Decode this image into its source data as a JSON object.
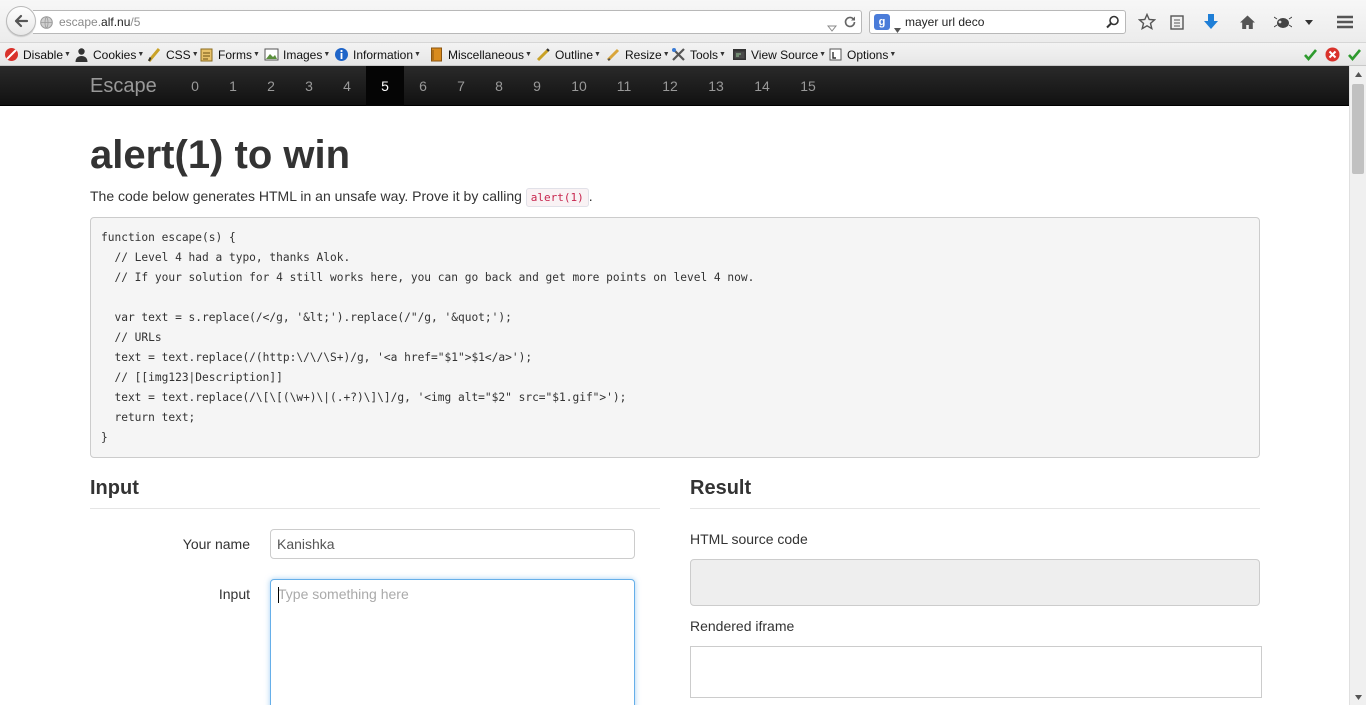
{
  "browser": {
    "url_prefix": "escape.",
    "url_domain": "alf.nu",
    "url_path": "/5",
    "search_engine_icon": "google-icon",
    "search_engine_letter": "g",
    "search_query": "mayer url deco"
  },
  "addon_bar": {
    "items": [
      {
        "label": "Disable",
        "icon": "disable-icon"
      },
      {
        "label": "Cookies",
        "icon": "cookies-icon"
      },
      {
        "label": "CSS",
        "icon": "css-icon"
      },
      {
        "label": "Forms",
        "icon": "forms-icon"
      },
      {
        "label": "Images",
        "icon": "images-icon"
      },
      {
        "label": "Information",
        "icon": "information-icon"
      },
      {
        "label": "Miscellaneous",
        "icon": "miscellaneous-icon"
      },
      {
        "label": "Outline",
        "icon": "outline-icon"
      },
      {
        "label": "Resize",
        "icon": "resize-icon"
      },
      {
        "label": "Tools",
        "icon": "tools-icon"
      },
      {
        "label": "View Source",
        "icon": "view-source-icon"
      },
      {
        "label": "Options",
        "icon": "options-icon"
      }
    ]
  },
  "site": {
    "brand": "Escape",
    "levels": [
      "0",
      "1",
      "2",
      "3",
      "4",
      "5",
      "6",
      "7",
      "8",
      "9",
      "10",
      "11",
      "12",
      "13",
      "14",
      "15"
    ],
    "active_level": "5"
  },
  "challenge": {
    "title": "alert(1) to win",
    "intro_text": "The code below generates HTML in an unsafe way. Prove it by calling",
    "intro_code": "alert(1)",
    "intro_end": ".",
    "code_lines": [
      "function escape(s) {",
      "  // Level 4 had a typo, thanks Alok.",
      "  // If your solution for 4 still works here, you can go back and get more points on level 4 now.",
      "",
      "  var text = s.replace(/</g, '&lt;').replace(/\"/g, '&quot;');",
      "  // URLs",
      "  text = text.replace(/(http:\\/\\/\\S+)/g, '<a href=\"$1\">$1</a>');",
      "  // [[img123|Description]]",
      "  text = text.replace(/\\[\\[(\\w+)\\|(.+?)\\]\\]/g, '<img alt=\"$2\" src=\"$1.gif\">');",
      "  return text;",
      "}"
    ]
  },
  "input_section": {
    "heading": "Input",
    "name_label": "Your name",
    "name_value": "Kanishka",
    "input_label": "Input",
    "input_placeholder": "Type something here"
  },
  "result_section": {
    "heading": "Result",
    "source_label": "HTML source code",
    "iframe_label": "Rendered iframe"
  },
  "colors": {
    "navbar": "#111111",
    "code_pink": "#c7254e",
    "focus_blue": "#66afe9"
  }
}
